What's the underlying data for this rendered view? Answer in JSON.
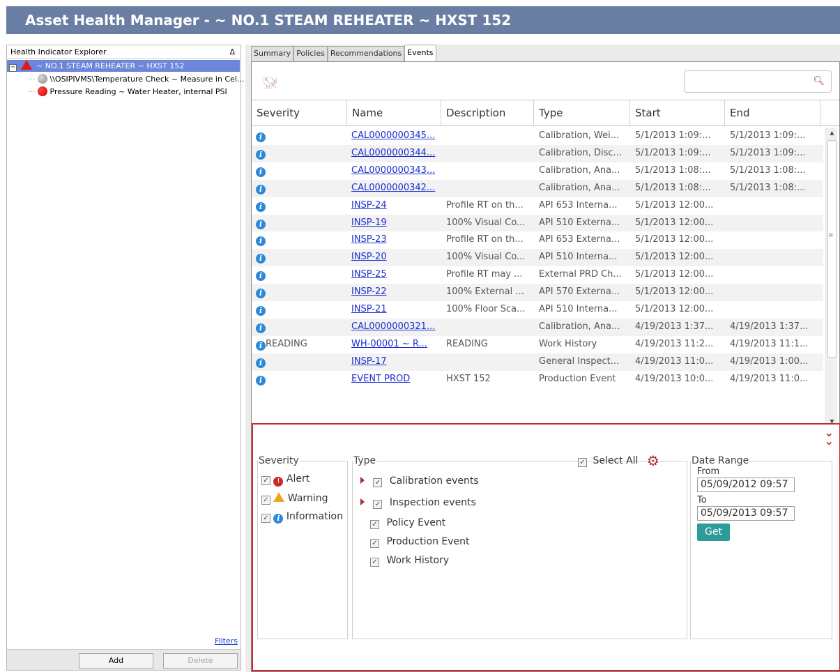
{
  "app": {
    "title": "Asset Health Manager -  ~ NO.1 STEAM REHEATER ~ HXST 152"
  },
  "explorer": {
    "header": "Health Indicator Explorer",
    "sort_glyph": "Δ",
    "tree": [
      {
        "label": "~ NO.1 STEAM REHEATER ~ HXST 152",
        "status_color": "#e01a1a",
        "selected": true
      },
      {
        "label": "\\\\OSIPIVMS\\Temperature Check ~ Measure in Cel...",
        "status_color": "#9a9a9a"
      },
      {
        "label": "Pressure Reading ~ Water Heater, internal PSI",
        "status_color": "#e01a1a"
      }
    ],
    "filters_link": "Filters",
    "add_label": "Add",
    "delete_label": "Delete"
  },
  "tabs": [
    {
      "label": "Summary"
    },
    {
      "label": "Policies"
    },
    {
      "label": "Recommendations"
    },
    {
      "label": "Events",
      "active": true
    }
  ],
  "grid": {
    "columns": [
      "Severity",
      "Name",
      "Description",
      "Type",
      "Start",
      "End"
    ],
    "rows": [
      {
        "severity": "",
        "name": "CAL0000000345...",
        "description": "",
        "type": "Calibration, Wei...",
        "start": "5/1/2013 1:09:...",
        "end": "5/1/2013 1:09:..."
      },
      {
        "severity": "",
        "name": "CAL0000000344...",
        "description": "",
        "type": "Calibration, Disc...",
        "start": "5/1/2013 1:09:...",
        "end": "5/1/2013 1:09:..."
      },
      {
        "severity": "",
        "name": "CAL0000000343...",
        "description": "",
        "type": "Calibration, Ana...",
        "start": "5/1/2013 1:08:...",
        "end": "5/1/2013 1:08:..."
      },
      {
        "severity": "",
        "name": "CAL0000000342...",
        "description": "",
        "type": "Calibration, Ana...",
        "start": "5/1/2013 1:08:...",
        "end": "5/1/2013 1:08:..."
      },
      {
        "severity": "",
        "name": "INSP-24",
        "description": "Profile RT on th...",
        "type": "API 653 Interna...",
        "start": "5/1/2013 12:00...",
        "end": ""
      },
      {
        "severity": "",
        "name": "INSP-19",
        "description": "100% Visual Co...",
        "type": "API 510 Externa...",
        "start": "5/1/2013 12:00...",
        "end": ""
      },
      {
        "severity": "",
        "name": "INSP-23",
        "description": "Profile RT on th...",
        "type": "API 653 Externa...",
        "start": "5/1/2013 12:00...",
        "end": ""
      },
      {
        "severity": "",
        "name": "INSP-20",
        "description": "100% Visual Co...",
        "type": "API 510 Interna...",
        "start": "5/1/2013 12:00...",
        "end": ""
      },
      {
        "severity": "",
        "name": "INSP-25",
        "description": "Profile RT may ...",
        "type": "External PRD Ch...",
        "start": "5/1/2013 12:00...",
        "end": ""
      },
      {
        "severity": "",
        "name": "INSP-22",
        "description": "100% External ...",
        "type": "API 570 Externa...",
        "start": "5/1/2013 12:00...",
        "end": ""
      },
      {
        "severity": "",
        "name": "INSP-21",
        "description": "100% Floor Sca...",
        "type": "API 510 Interna...",
        "start": "5/1/2013 12:00...",
        "end": ""
      },
      {
        "severity": "",
        "name": "CAL0000000321...",
        "description": "",
        "type": "Calibration, Ana...",
        "start": "4/19/2013 1:37...",
        "end": "4/19/2013 1:37..."
      },
      {
        "severity": "READING",
        "name": "WH-00001 ~ R...",
        "description": "READING",
        "type": "Work History",
        "start": "4/19/2013 11:2...",
        "end": "4/19/2013 11:1..."
      },
      {
        "severity": "",
        "name": "INSP-17",
        "description": "",
        "type": "General Inspect...",
        "start": "4/19/2013 11:0...",
        "end": "4/19/2013 1:00..."
      },
      {
        "severity": "",
        "name": "EVENT PROD",
        "description": "HXST 152",
        "type": "Production Event",
        "start": "4/19/2013 10:0...",
        "end": "4/19/2013 11:0..."
      }
    ]
  },
  "filter": {
    "severity_legend": "Severity",
    "severity_items": [
      {
        "label": "Alert",
        "checked": true
      },
      {
        "label": "Warning",
        "checked": true
      },
      {
        "label": "Information",
        "checked": true
      }
    ],
    "type_legend": "Type",
    "select_all_label": "Select All",
    "type_items": [
      {
        "label": "Calibration events",
        "checked": true,
        "expandable": true
      },
      {
        "label": "Inspection events",
        "checked": true,
        "expandable": true
      },
      {
        "label": "Policy Event",
        "checked": true
      },
      {
        "label": "Production Event",
        "checked": true
      },
      {
        "label": "Work History",
        "checked": true
      }
    ],
    "date_legend": "Date Range",
    "from_label": "From",
    "from_value": "05/09/2012 09:57",
    "to_label": "To",
    "to_value": "05/09/2013 09:57",
    "get_label": "Get"
  },
  "colors": {
    "title_bar": "#6a7ea3",
    "selection": "#6c86d9",
    "filter_border": "#c72b2b",
    "get_button": "#2d9b98",
    "info_icon": "#2f88d6"
  }
}
